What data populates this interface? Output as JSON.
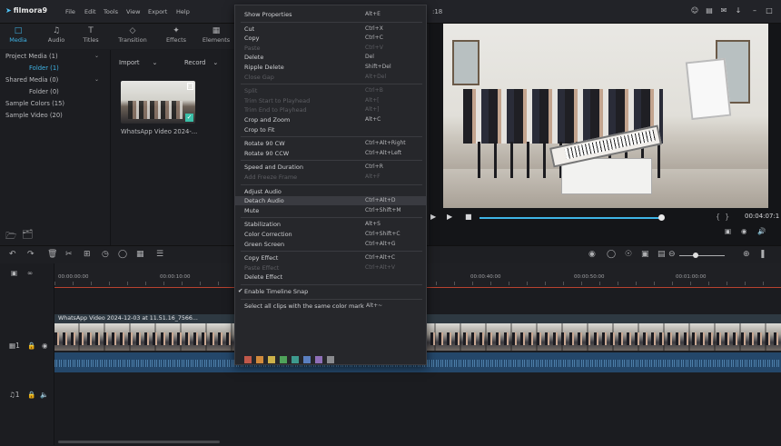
{
  "app": {
    "brand": "filmora9",
    "menu": [
      "File",
      "Edit",
      "Tools",
      "View",
      "Export",
      "Help"
    ],
    "window_title_fragment": ":18"
  },
  "media_tabs": [
    {
      "label": "Media",
      "icon": "folder-icon",
      "active": true
    },
    {
      "label": "Audio",
      "icon": "music-note-icon",
      "active": false
    },
    {
      "label": "Titles",
      "icon": "text-icon",
      "active": false
    },
    {
      "label": "Transition",
      "icon": "transition-icon",
      "active": false
    },
    {
      "label": "Effects",
      "icon": "effects-icon",
      "active": false
    },
    {
      "label": "Elements",
      "icon": "elements-icon",
      "active": false
    }
  ],
  "library": {
    "items": [
      {
        "label": "Project Media (1)",
        "caret": true
      },
      {
        "label": "Folder (1)",
        "selected": true
      },
      {
        "label": "Shared Media (0)",
        "caret": true
      },
      {
        "label": "Folder (0)"
      },
      {
        "label": "Sample Colors (15)"
      },
      {
        "label": "Sample Video (20)"
      }
    ]
  },
  "media_panel": {
    "import_label": "Import",
    "record_label": "Record",
    "clip_name": "WhatsApp Video 2024-..."
  },
  "preview": {
    "timecode": "00:04:07:1",
    "progress_fraction": 0.82
  },
  "timeline": {
    "ruler_ticks": [
      "00:00:00:00",
      "00:00:10:00",
      "00:00:40:00",
      "00:00:50:00",
      "00:01:00:00"
    ],
    "clip_label": "WhatsApp Video 2024-12-03 at 11.51.16_7566..."
  },
  "context_menu": {
    "items": [
      {
        "label": "Show Properties",
        "shortcut": "Alt+E",
        "enabled": true
      },
      {
        "sep": true
      },
      {
        "label": "Cut",
        "shortcut": "Ctrl+X",
        "enabled": true
      },
      {
        "label": "Copy",
        "shortcut": "Ctrl+C",
        "enabled": true
      },
      {
        "label": "Paste",
        "shortcut": "Ctrl+V",
        "enabled": false
      },
      {
        "label": "Delete",
        "shortcut": "Del",
        "enabled": true
      },
      {
        "label": "Ripple Delete",
        "shortcut": "Shift+Del",
        "enabled": true
      },
      {
        "label": "Close Gap",
        "shortcut": "Alt+Del",
        "enabled": false
      },
      {
        "sep": true
      },
      {
        "label": "Split",
        "shortcut": "Ctrl+B",
        "enabled": false
      },
      {
        "label": "Trim Start to Playhead",
        "shortcut": "Alt+[",
        "enabled": false
      },
      {
        "label": "Trim End to Playhead",
        "shortcut": "Alt+]",
        "enabled": false
      },
      {
        "label": "Crop and Zoom",
        "shortcut": "Alt+C",
        "enabled": true
      },
      {
        "label": "Crop to Fit",
        "shortcut": "",
        "enabled": true
      },
      {
        "sep": true
      },
      {
        "label": "Rotate 90 CW",
        "shortcut": "Ctrl+Alt+Right",
        "enabled": true
      },
      {
        "label": "Rotate 90 CCW",
        "shortcut": "Ctrl+Alt+Left",
        "enabled": true
      },
      {
        "sep": true
      },
      {
        "label": "Speed and Duration",
        "shortcut": "Ctrl+R",
        "enabled": true
      },
      {
        "label": "Add Freeze Frame",
        "shortcut": "Alt+F",
        "enabled": false
      },
      {
        "sep": true
      },
      {
        "label": "Adjust Audio",
        "shortcut": "",
        "enabled": true
      },
      {
        "label": "Detach Audio",
        "shortcut": "Ctrl+Alt+D",
        "enabled": true,
        "highlighted": true
      },
      {
        "label": "Mute",
        "shortcut": "Ctrl+Shift+M",
        "enabled": true
      },
      {
        "sep": true
      },
      {
        "label": "Stabilization",
        "shortcut": "Alt+S",
        "enabled": true
      },
      {
        "label": "Color Correction",
        "shortcut": "Ctrl+Shift+C",
        "enabled": true
      },
      {
        "label": "Green Screen",
        "shortcut": "Ctrl+Alt+G",
        "enabled": true
      },
      {
        "sep": true
      },
      {
        "label": "Copy Effect",
        "shortcut": "Ctrl+Alt+C",
        "enabled": true
      },
      {
        "label": "Paste Effect",
        "shortcut": "Ctrl+Alt+V",
        "enabled": false
      },
      {
        "label": "Delete Effect",
        "shortcut": "",
        "enabled": true
      },
      {
        "sep": true
      },
      {
        "label": "Enable Timeline Snap",
        "shortcut": "",
        "enabled": true,
        "checked": true
      },
      {
        "sep": true
      },
      {
        "label": "Select all clips with the same color mark",
        "shortcut": "Alt+~",
        "enabled": true
      }
    ],
    "color_marks": [
      "#c0584a",
      "#d18a3c",
      "#cdb24a",
      "#4fa35a",
      "#3d9a8e",
      "#5a7fc0",
      "#8e6fb8",
      "#8a8b8f"
    ]
  },
  "colors": {
    "accent": "#3fb4e6",
    "playhead_line": "#b8422f",
    "audio_track": "#24476a"
  }
}
